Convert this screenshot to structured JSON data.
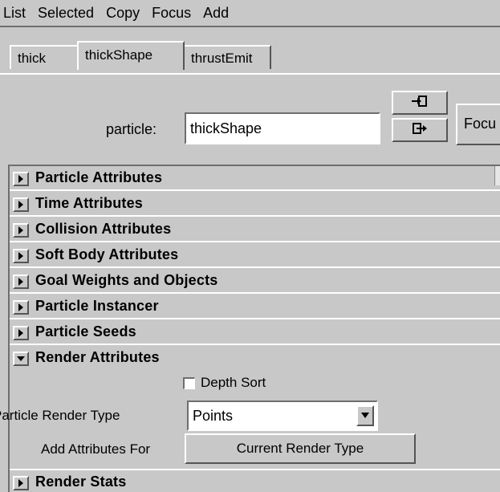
{
  "menubar": {
    "items": [
      "List",
      "Selected",
      "Copy",
      "Focus",
      "Add"
    ]
  },
  "tabs": [
    {
      "label": "thick",
      "active": false
    },
    {
      "label": "thickShape",
      "active": true
    },
    {
      "label": "thrustEmit",
      "active": false
    }
  ],
  "particle_field": {
    "label": "particle:",
    "value": "thickShape",
    "focus_label": "Focu"
  },
  "icons": {
    "load_selected": "arrow-into-box-icon",
    "select_node": "arrow-out-box-icon",
    "collapsed": "triangle-right-icon",
    "expanded": "triangle-down-icon"
  },
  "sections": [
    {
      "title": "Particle Attributes",
      "expanded": false
    },
    {
      "title": "Time Attributes",
      "expanded": false
    },
    {
      "title": "Collision Attributes",
      "expanded": false
    },
    {
      "title": "Soft Body Attributes",
      "expanded": false
    },
    {
      "title": "Goal Weights and Objects",
      "expanded": false
    },
    {
      "title": "Particle Instancer",
      "expanded": false
    },
    {
      "title": "Particle Seeds",
      "expanded": false
    },
    {
      "title": "Render Attributes",
      "expanded": true
    },
    {
      "title": "Render Stats",
      "expanded": false
    }
  ],
  "render_attributes": {
    "depth_sort_label": "Depth Sort",
    "depth_sort_checked": false,
    "render_type_label": "Particle Render Type",
    "render_type_value": "Points",
    "add_attributes_label": "Add Attributes For",
    "current_render_type_button": "Current Render Type"
  },
  "colors": {
    "background": "#c8c8c8",
    "highlight": "#ffffff",
    "shadow": "#555555"
  }
}
